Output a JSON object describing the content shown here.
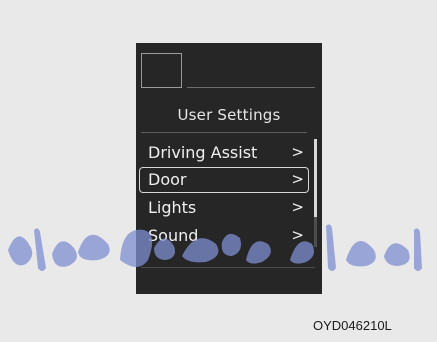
{
  "screen": {
    "title": "User Settings",
    "menu_items": [
      {
        "label": "Driving Assist",
        "chevron": ">",
        "selected": false
      },
      {
        "label": "Door",
        "chevron": ">",
        "selected": true
      },
      {
        "label": "Lights",
        "chevron": ">",
        "selected": false
      },
      {
        "label": "Sound",
        "chevron": ">",
        "selected": false
      }
    ]
  },
  "watermark": {
    "text": "مداد خودرو فارما",
    "color": "#7f8fd0"
  },
  "figure_code": "OYD046210L"
}
